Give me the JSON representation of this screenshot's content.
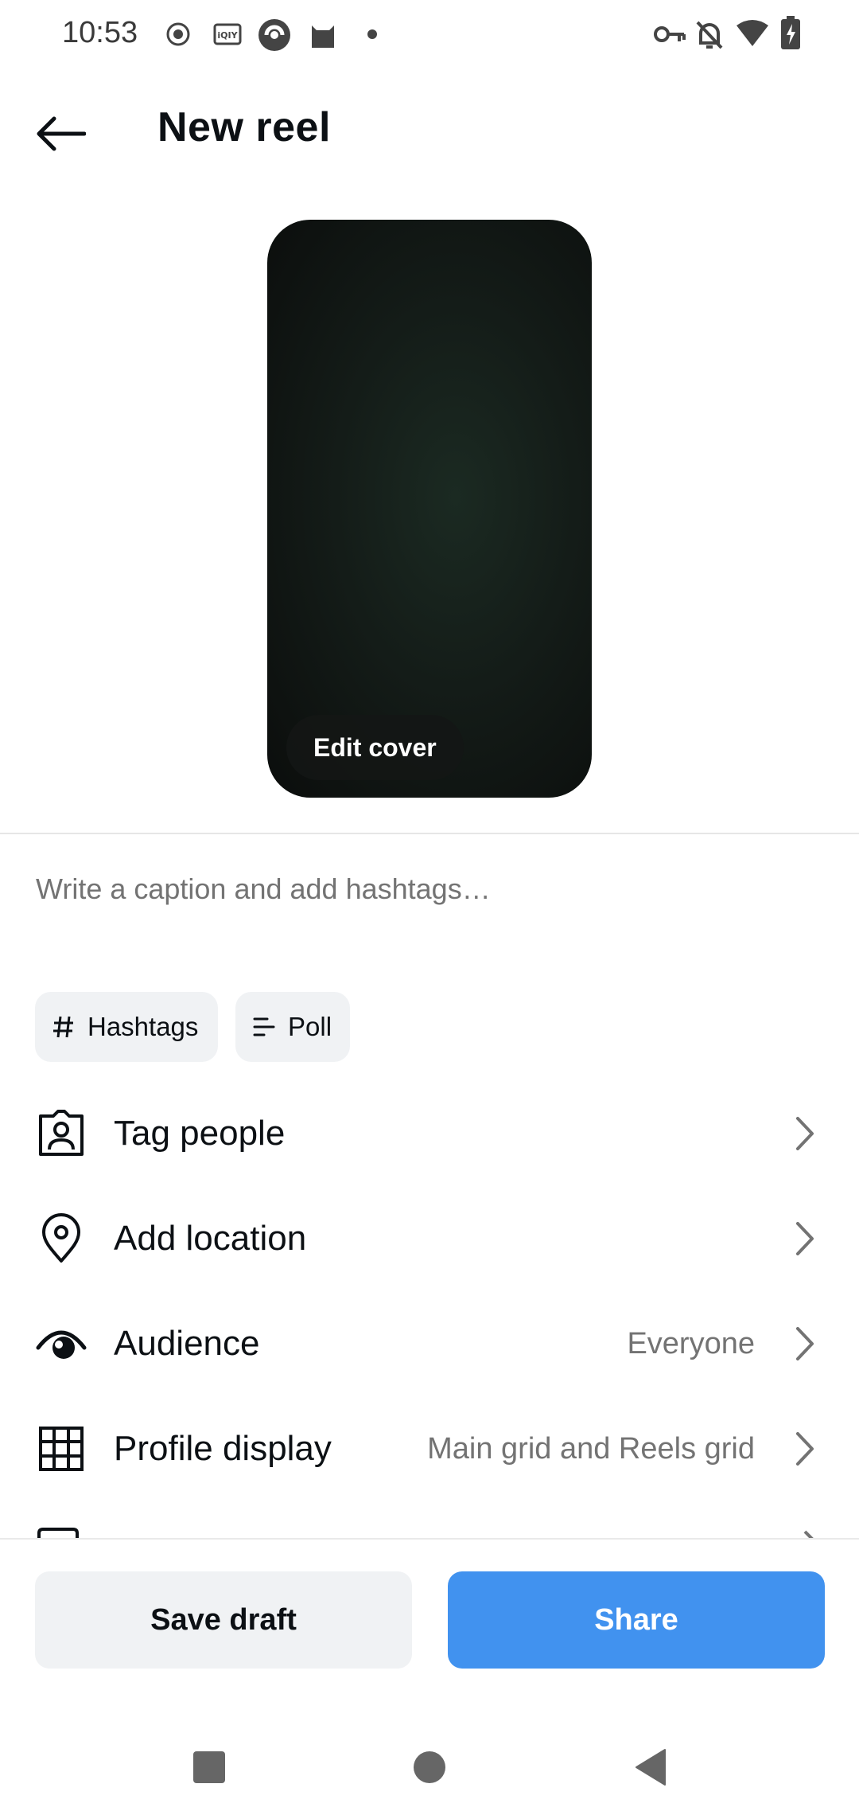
{
  "status_bar": {
    "time": "10:53",
    "left_icons": [
      "record-icon",
      "iqiyi-icon",
      "app-icon",
      "cat-icon",
      "dot-icon"
    ],
    "right_icons": [
      "vpn-key-icon",
      "notifications-off-icon",
      "wifi-icon",
      "battery-charging-icon"
    ]
  },
  "header": {
    "title": "New reel"
  },
  "cover": {
    "edit_label": "Edit cover"
  },
  "caption": {
    "placeholder": "Write a caption and add hashtags…"
  },
  "chips": [
    {
      "label": "Hashtags",
      "icon": "hashtag-icon"
    },
    {
      "label": "Poll",
      "icon": "poll-icon"
    }
  ],
  "options": [
    {
      "label": "Tag people",
      "value": "",
      "icon": "tag-people-icon"
    },
    {
      "label": "Add location",
      "value": "",
      "icon": "location-pin-icon"
    },
    {
      "label": "Audience",
      "value": "Everyone",
      "icon": "audience-eye-icon"
    },
    {
      "label": "Profile display",
      "value": "Main grid and Reels grid",
      "icon": "grid-icon"
    }
  ],
  "actions": {
    "save_draft": "Save draft",
    "share": "Share"
  },
  "colors": {
    "share_button": "#4192ef",
    "secondary_button": "#f0f2f4",
    "muted_text": "#737373"
  },
  "nav": [
    "recents-square-icon",
    "home-circle-icon",
    "back-triangle-icon"
  ]
}
